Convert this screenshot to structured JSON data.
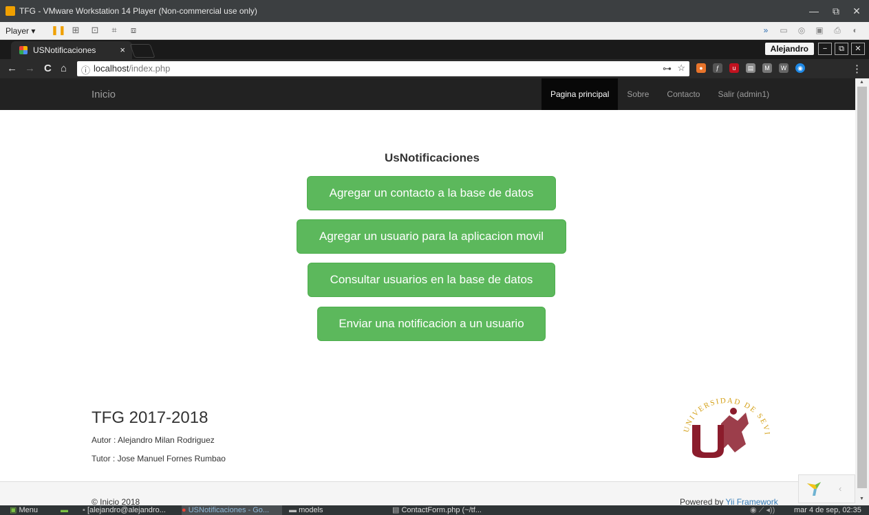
{
  "vm": {
    "title": "TFG - VMware Workstation 14 Player (Non-commercial use only)",
    "player_label": "Player ▾",
    "minimize": "—",
    "restore": "⧉",
    "close": "✕"
  },
  "browser": {
    "tab_title": "USNotificaciones",
    "tab_close": "×",
    "profile": "Alejandro",
    "url_host": "localhost",
    "url_path": "/index.php",
    "back": "←",
    "forward": "→",
    "reload": "C",
    "home": "⌂",
    "info": "ⓘ",
    "key": "⊶",
    "star": "☆",
    "menu": "⋮"
  },
  "site": {
    "brand": "Inicio",
    "nav": [
      "Pagina principal",
      "Sobre",
      "Contacto",
      "Salir (admin1)"
    ],
    "title": "UsNotificaciones",
    "buttons": [
      "Agregar un contacto a la base de datos",
      "Agregar un usuario para la aplicacion movil",
      "Consultar usuarios en la base de datos",
      "Enviar una notificacion a un usuario"
    ],
    "footer_title": "TFG 2017-2018",
    "author": "Autor : Alejandro Milan Rodriguez",
    "tutor": "Tutor : Jose Manuel Fornes Rumbao",
    "seal_text": "UNIVERSIDAD DE SEVILLA",
    "copyright": "© Inicio 2018",
    "powered_prefix": "Powered by ",
    "powered_link": "Yii Framework"
  },
  "taskbar": {
    "menu": "Menu",
    "items": [
      "[alejandro@alejandro...",
      "USNotificaciones - Go...",
      "models",
      "ContactForm.php (~/tf..."
    ],
    "clock": "mar 4 de sep, 02:35"
  },
  "colors": {
    "success": "#5cb85c",
    "navbar": "#222222",
    "link": "#337ab7",
    "seal_gold": "#d4a017",
    "seal_red": "#8b1c2c"
  }
}
